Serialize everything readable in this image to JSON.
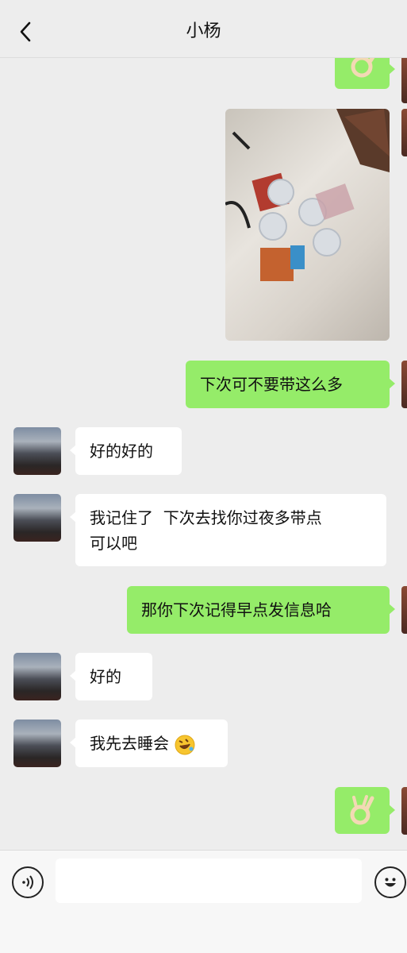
{
  "header": {
    "title": "小杨",
    "back_icon": "chevron-left-icon"
  },
  "messages": [
    {
      "id": "m0",
      "sender": "me",
      "type": "emoji",
      "emoji": "ok-hand-emoji"
    },
    {
      "id": "m1",
      "sender": "me",
      "type": "image",
      "description": "photo"
    },
    {
      "id": "m2",
      "sender": "me",
      "type": "text",
      "text": "下次可不要带这么多"
    },
    {
      "id": "m3",
      "sender": "them",
      "type": "text",
      "text": "好的好的"
    },
    {
      "id": "m4",
      "sender": "them",
      "type": "text",
      "lines": [
        "我记住了  下次去找你过夜多带点",
        "可以吧"
      ]
    },
    {
      "id": "m5",
      "sender": "me",
      "type": "text",
      "text": "那你下次记得早点发信息哈"
    },
    {
      "id": "m6",
      "sender": "them",
      "type": "text",
      "text": "好的"
    },
    {
      "id": "m7",
      "sender": "them",
      "type": "text",
      "text": "我先去睡会",
      "emoji": "rofl-emoji"
    },
    {
      "id": "m8",
      "sender": "me",
      "type": "emoji",
      "emoji": "ok-hand-emoji"
    }
  ],
  "input": {
    "value": "",
    "placeholder": ""
  },
  "icons": {
    "voice": "voice-icon",
    "emoji": "smiley-icon"
  },
  "colors": {
    "me_bubble": "#95ec69",
    "them_bubble": "#ffffff",
    "background": "#ededed"
  }
}
